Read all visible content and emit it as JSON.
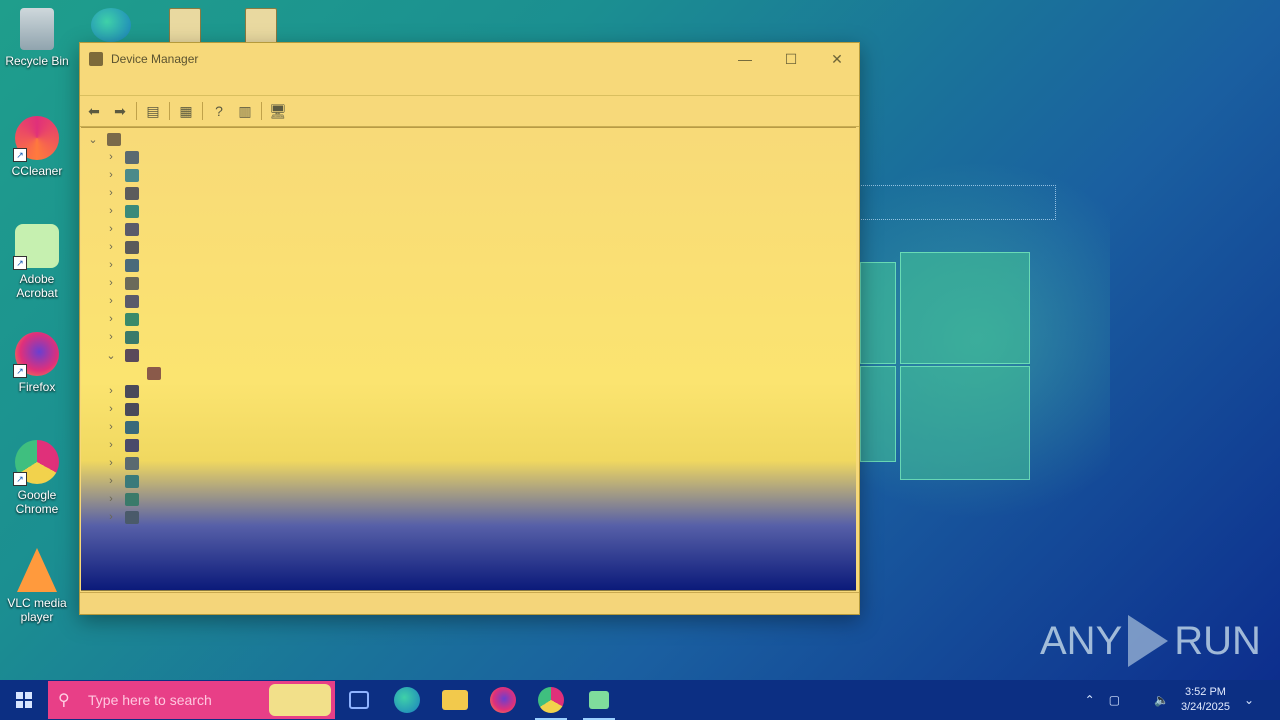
{
  "desktop": {
    "icons": [
      {
        "label": "Recycle Bin"
      },
      {
        "label": "CCleaner"
      },
      {
        "label": "Adobe Acrobat"
      },
      {
        "label": "Firefox"
      },
      {
        "label": "Google Chrome"
      },
      {
        "label": "VLC media player"
      }
    ],
    "watermark": {
      "left": "ANY",
      "right": "RUN"
    }
  },
  "window": {
    "title": "Device Manager",
    "controls": {
      "minimize": "—",
      "maximize": "☐",
      "close": "✕"
    },
    "toolbar": [
      {
        "name": "back-icon",
        "glyph": "⬅"
      },
      {
        "name": "forward-icon",
        "glyph": "➡"
      },
      {
        "name": "properties-icon",
        "glyph": "▤"
      },
      {
        "name": "view-icon",
        "glyph": "▦"
      },
      {
        "name": "help-icon",
        "glyph": "?"
      },
      {
        "name": "console-tree-icon",
        "glyph": "▥"
      },
      {
        "name": "scan-hardware-icon",
        "glyph": "🖥"
      }
    ],
    "tree": {
      "nodes": [
        {
          "icon": "computer-root-icon",
          "expanded": true,
          "color": "#7a6a4a"
        },
        {
          "icon": "audio-icon",
          "color": "#5a6a70"
        },
        {
          "icon": "computer-icon",
          "color": "#4a8a8a"
        },
        {
          "icon": "disk-drive-icon",
          "color": "#5c5c5c"
        },
        {
          "icon": "display-adapter-icon",
          "color": "#3a8a7a"
        },
        {
          "icon": "dvd-drive-icon",
          "color": "#5a5a6a"
        },
        {
          "icon": "hid-icon",
          "color": "#5a5a5a"
        },
        {
          "icon": "ide-controller-icon",
          "color": "#4a6a7a"
        },
        {
          "icon": "keyboard-icon",
          "color": "#6a6a5a"
        },
        {
          "icon": "mouse-icon",
          "color": "#5a5a6a"
        },
        {
          "icon": "monitor-icon",
          "color": "#3a8a6a"
        },
        {
          "icon": "network-adapter-icon",
          "color": "#3a7a6a"
        },
        {
          "icon": "other-devices-icon",
          "expanded": true,
          "color": "#5a4a5a"
        },
        {
          "icon": "unknown-device-icon",
          "child": true,
          "color": "#8a5a4a"
        },
        {
          "icon": "port-icon",
          "color": "#4a4a5a"
        },
        {
          "icon": "print-queue-icon",
          "color": "#4a4a5a"
        },
        {
          "icon": "processor-icon",
          "color": "#3a6a7a"
        },
        {
          "icon": "software-device-icon",
          "color": "#4a4a6a"
        },
        {
          "icon": "sound-controller-icon",
          "color": "#5a6a70"
        },
        {
          "icon": "storage-controller-icon",
          "color": "#3a7a7a"
        },
        {
          "icon": "system-device-icon",
          "color": "#3a7a6a"
        },
        {
          "icon": "usb-controller-icon",
          "color": "#4a5a6a"
        }
      ]
    }
  },
  "taskbar": {
    "search_placeholder": "Type here to search",
    "apps": [
      {
        "name": "task-view-icon",
        "color": "#8fb3ff"
      },
      {
        "name": "edge-icon",
        "color": "#1fbf8f"
      },
      {
        "name": "file-explorer-icon",
        "color": "#f2c94c"
      },
      {
        "name": "firefox-icon",
        "color": "#ff7a3d"
      },
      {
        "name": "chrome-icon",
        "color": "#e6a340"
      },
      {
        "name": "device-manager-icon",
        "color": "#7fdc9c"
      }
    ],
    "tray": {
      "time": "3:52 PM",
      "date": "3/24/2025"
    }
  }
}
